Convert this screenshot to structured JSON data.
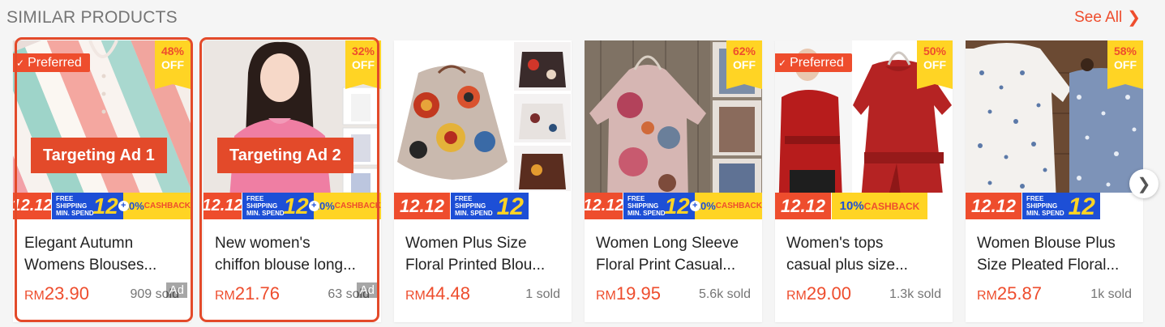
{
  "header": {
    "title": "SIMILAR PRODUCTS",
    "see_all": "See All",
    "chevron": "❯"
  },
  "colors": {
    "accent": "#ee4d2d",
    "highlight": "#e34a2a",
    "badge_yellow": "#ffd424",
    "shipping_blue": "#1d4fd6"
  },
  "promo": {
    "d1212": "12.12",
    "free_l1": "FREE",
    "free_l2": "SHIPPING",
    "free_l3": "MIN. SPEND",
    "free_num": "12",
    "plus": "+",
    "cash_pct": "10%",
    "cash_word": " CASHBACK"
  },
  "badges": {
    "preferred": "Preferred",
    "check": "✓",
    "ad": "Ad",
    "off": "OFF"
  },
  "targets": [
    "Targeting Ad 1",
    "Targeting Ad 2"
  ],
  "products": [
    {
      "name_l1": "Elegant Autumn",
      "name_l2": "Womens Blouses...",
      "currency": "RM",
      "price": "23.90",
      "sold": "909 sold",
      "discount": "48%",
      "preferred": true,
      "ad": true,
      "promo": "full"
    },
    {
      "name_l1": "New women's",
      "name_l2": "chiffon blouse long...",
      "currency": "RM",
      "price": "21.76",
      "sold": "63 sold",
      "discount": "32%",
      "preferred": false,
      "ad": true,
      "promo": "full"
    },
    {
      "name_l1": "Women Plus Size",
      "name_l2": "Floral Printed Blou...",
      "currency": "RM",
      "price": "44.48",
      "sold": "1 sold",
      "discount": "",
      "preferred": false,
      "ad": false,
      "promo": "shipping"
    },
    {
      "name_l1": "Women Long Sleeve",
      "name_l2": "Floral Print Casual...",
      "currency": "RM",
      "price": "19.95",
      "sold": "5.6k sold",
      "discount": "62%",
      "preferred": false,
      "ad": false,
      "promo": "full"
    },
    {
      "name_l1": "Women's tops",
      "name_l2": "casual plus size...",
      "currency": "RM",
      "price": "29.00",
      "sold": "1.3k sold",
      "discount": "50%",
      "preferred": true,
      "ad": false,
      "promo": "cashback"
    },
    {
      "name_l1": "Women Blouse Plus",
      "name_l2": "Size Pleated Floral...",
      "currency": "RM",
      "price": "25.87",
      "sold": "1k sold",
      "discount": "58%",
      "preferred": false,
      "ad": false,
      "promo": "shipping"
    }
  ],
  "next_icon": "❯"
}
